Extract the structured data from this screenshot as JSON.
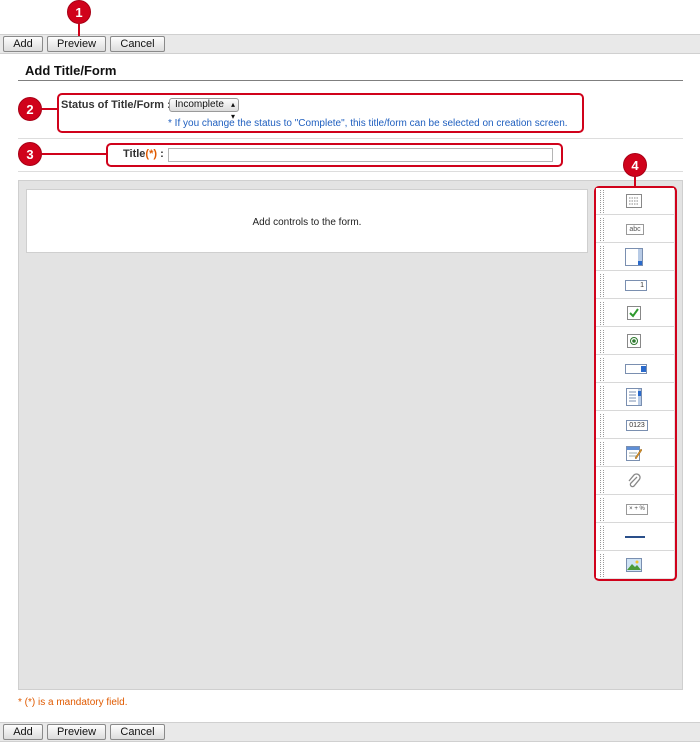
{
  "toolbar": {
    "add_label": "Add",
    "preview_label": "Preview",
    "cancel_label": "Cancel"
  },
  "markers": [
    "1",
    "2",
    "3",
    "4"
  ],
  "page_title": "Add Title/Form",
  "status": {
    "label": "Status of Title/Form :",
    "selected": "Incomplete",
    "hint": "* If you change the status to \"Complete\", this title/form can be selected on creation screen."
  },
  "title_field": {
    "label": "Title",
    "required_mark": "(*)",
    "colon": ":",
    "value": ""
  },
  "canvas": {
    "empty_text": "Add controls to the form."
  },
  "palette": {
    "items": [
      {
        "icon": "label-text-icon"
      },
      {
        "icon": "text-box-icon",
        "text": "abc"
      },
      {
        "icon": "text-area-icon"
      },
      {
        "icon": "number-field-icon",
        "text": "1"
      },
      {
        "icon": "checkbox-icon"
      },
      {
        "icon": "radio-button-icon"
      },
      {
        "icon": "dropdown-icon"
      },
      {
        "icon": "list-box-icon"
      },
      {
        "icon": "serial-number-icon",
        "text": "0123"
      },
      {
        "icon": "date-picker-icon"
      },
      {
        "icon": "attachment-icon"
      },
      {
        "icon": "calculation-icon",
        "text": "× + %"
      },
      {
        "icon": "horizontal-line-icon"
      },
      {
        "icon": "image-icon"
      }
    ]
  },
  "footer_note": "* (*) is a mandatory field.",
  "colors": {
    "marker": "#d0021b",
    "hint": "#1f5fbf",
    "required": "#e05a00"
  }
}
